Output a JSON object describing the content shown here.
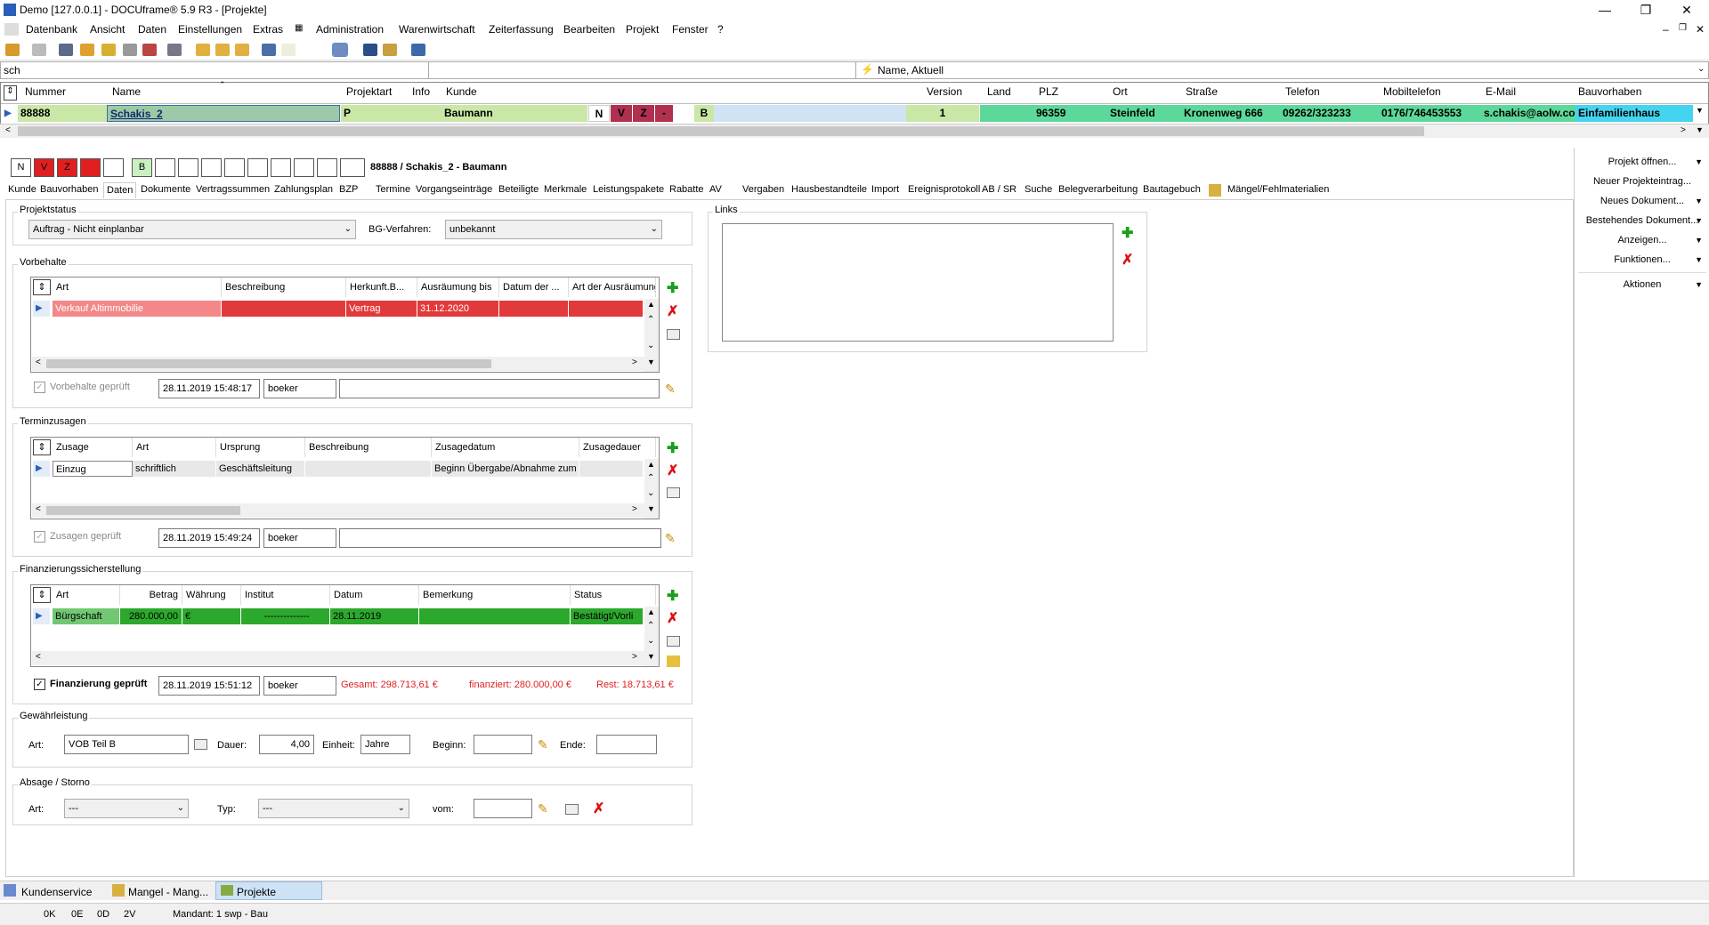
{
  "window": {
    "title": "Demo [127.0.0.1] - DOCUframe® 5.9 R3 - [Projekte]"
  },
  "menu": [
    "Datenbank",
    "Ansicht",
    "Daten",
    "Einstellungen",
    "Extras",
    "Administration",
    "Warenwirtschaft",
    "Zeiterfassung",
    "Bearbeiten",
    "Projekt",
    "Fenster",
    "?"
  ],
  "search": {
    "value": "sch",
    "sort": "Name, Aktuell"
  },
  "topgrid": {
    "headers": [
      "Nummer",
      "Name",
      "Projektart",
      "Info",
      "Kunde",
      "Version",
      "Land",
      "PLZ",
      "Ort",
      "Straße",
      "Telefon",
      "Mobiltelefon",
      "E-Mail",
      "Bauvorhaben"
    ],
    "row": {
      "nummer": "88888",
      "name": "Schakis_2",
      "projektart": "P",
      "kunde": "Baumann",
      "n": "N",
      "v": "V",
      "z": "Z",
      "dash": "-",
      "b": "B",
      "version": "1",
      "plz": "96359",
      "ort": "Steinfeld",
      "strasse": "Kronenweg 666",
      "telefon": "09262/323233",
      "mobil": "0176/746453553",
      "email": "s.chakis@aolw.com",
      "bauvorhaben": "Einfamilienhaus"
    }
  },
  "badges": {
    "n": "N",
    "v": "V",
    "z": "Z",
    "b": "B",
    "title": "88888 / Schakis_2 - Baumann"
  },
  "tabs": [
    "Kunde",
    "Bauvorhaben",
    "Daten",
    "Dokumente",
    "Vertragssummen",
    "Zahlungsplan",
    "BZP",
    "Termine",
    "Vorgangseinträge",
    "Beteiligte",
    "Merkmale",
    "Leistungspakete",
    "Rabatte",
    "AV",
    "Vergaben",
    "Hausbestandteile",
    "Import",
    "Ereignisprotokoll",
    "AB / SR",
    "Suche",
    "Belegverarbeitung",
    "Bautagebuch",
    "Mängel/Fehlmaterialien"
  ],
  "projektstatus": {
    "label": "Projektstatus",
    "status": "Auftrag - Nicht einplanbar",
    "bg_label": "BG-Verfahren:",
    "bg_value": "unbekannt"
  },
  "links": {
    "label": "Links"
  },
  "vorbehalte": {
    "label": "Vorbehalte",
    "headers": [
      "Art",
      "Beschreibung",
      "Herkunft.B...",
      "Ausräumung bis",
      "Datum der ...",
      "Art der Ausräumung"
    ],
    "row": {
      "art": "Verkauf Altimmobilie",
      "beschreibung": "",
      "herkunft": "Vertrag",
      "bis": "31.12.2020"
    },
    "checked_label": "Vorbehalte geprüft",
    "date": "28.11.2019 15:48:17",
    "user": "boeker"
  },
  "terminzusagen": {
    "label": "Terminzusagen",
    "headers": [
      "Zusage",
      "Art",
      "Ursprung",
      "Beschreibung",
      "Zusagedatum",
      "Zusagedauer"
    ],
    "row": {
      "zusage": "Einzug",
      "art": "schriftlich",
      "ursprung": "Geschäftsleitung",
      "beschreibung": "",
      "datum": "Beginn Übergabe/Abnahme zum"
    },
    "checked_label": "Zusagen geprüft",
    "date": "28.11.2019 15:49:24",
    "user": "boeker"
  },
  "finanzierung": {
    "label": "Finanzierungssicherstellung",
    "headers": [
      "Art",
      "Betrag",
      "Währung",
      "Institut",
      "Datum",
      "Bemerkung",
      "Status"
    ],
    "row": {
      "art": "Bürgschaft",
      "betrag": "280.000,00",
      "waehrung": "€",
      "institut": "--------------",
      "datum": "28.11.2019",
      "bemerkung": "",
      "status": "Bestätigt/Vorli"
    },
    "checked_label": "Finanzierung geprüft",
    "date": "28.11.2019 15:51:12",
    "user": "boeker",
    "gesamt": "Gesamt: 298.713,61 €",
    "finanziert": "finanziert: 280.000,00 €",
    "rest": "Rest: 18.713,61 €"
  },
  "gewaehr": {
    "label": "Gewährleistung",
    "art_label": "Art:",
    "art": "VOB Teil B",
    "dauer_label": "Dauer:",
    "dauer": "4,00",
    "einheit_label": "Einheit:",
    "einheit": "Jahre",
    "beginn_label": "Beginn:",
    "ende_label": "Ende:"
  },
  "absage": {
    "label": "Absage / Storno",
    "art_label": "Art:",
    "art": "---",
    "typ_label": "Typ:",
    "typ": "---",
    "vom_label": "vom:"
  },
  "side": [
    "Projekt öffnen...",
    "Neuer Projekteintrag...",
    "Neues Dokument...",
    "Bestehendes Dokument...",
    "Anzeigen...",
    "Funktionen...",
    "Aktionen"
  ],
  "tasktabs": [
    "Kundenservice",
    "Mangel - Mang...",
    "Projekte"
  ],
  "status": {
    "k": "0K",
    "e": "0E",
    "d": "0D",
    "v": "2V",
    "mandant": "Mandant: 1 swp - Bau"
  }
}
